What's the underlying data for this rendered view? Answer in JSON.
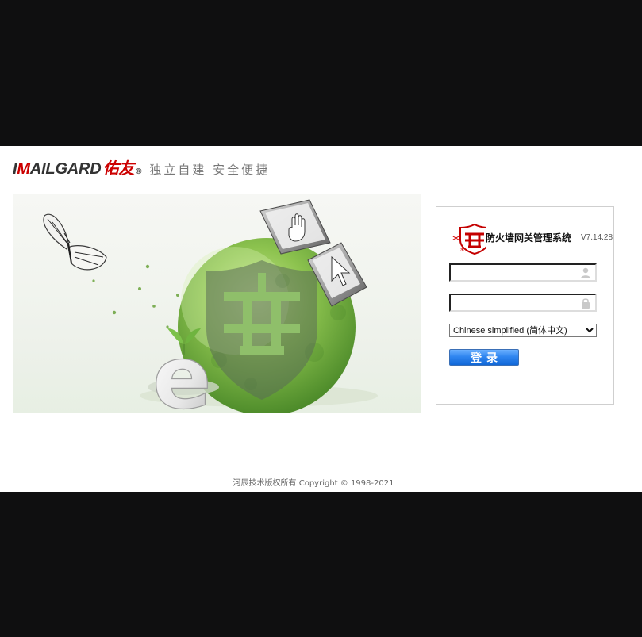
{
  "brand": {
    "logo_text_prefix": "I",
    "logo_text_accent": "M",
    "logo_text_main": "AILGARD",
    "logo_text_cn": "佑友",
    "registered_mark": "®",
    "slogan": "独立自建 安全便捷"
  },
  "hero": {
    "keycap_icon_name": "hand-cursor-icon",
    "keycap2_icon_name": "arrow-cursor-icon",
    "emblem_icon_name": "shield-emblem-icon",
    "e_logo_text": "e"
  },
  "login": {
    "system_title": "防火墙网关管理系统",
    "version": "V7.14.28",
    "username": {
      "value": "",
      "placeholder": ""
    },
    "password": {
      "value": "",
      "placeholder": ""
    },
    "language_selected": "Chinese simplified (简体中文)",
    "button_label": "登录"
  },
  "footer": {
    "copyright": "河辰技术版权所有 Copyright © 1998-2021"
  },
  "colors": {
    "brand_red": "#c00000",
    "button_blue": "#1f7ee8",
    "background": "#ffffff",
    "letterbox": "#0f0f10"
  }
}
